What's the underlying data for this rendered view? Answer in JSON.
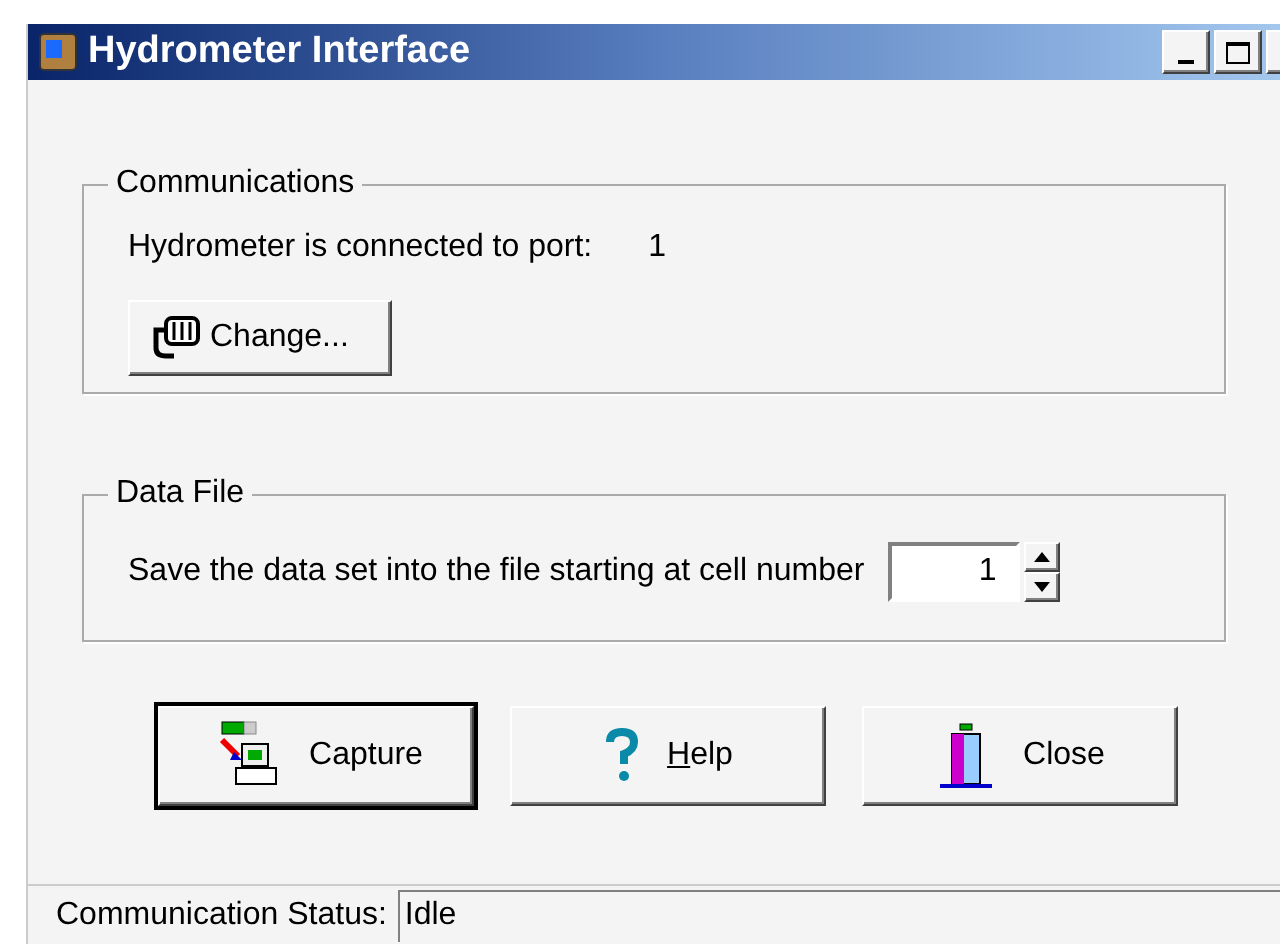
{
  "window": {
    "title": "Hydrometer Interface"
  },
  "communications": {
    "title": "Communications",
    "label": "Hydrometer is connected to port:",
    "port": "1",
    "button": "Change..."
  },
  "data_file": {
    "title": "Data File",
    "label": "Save the data set into the file starting at cell number",
    "cell": "1"
  },
  "buttons": [
    {
      "kind": "capture",
      "label": "Capture",
      "default": true,
      "mnemonic": false
    },
    {
      "kind": "help",
      "label": "Help",
      "default": false,
      "mnemonic": true
    },
    {
      "kind": "close",
      "label": "Close",
      "default": false,
      "mnemonic": false
    }
  ],
  "status_bar": {
    "label": "Communication Status:",
    "value": "Idle"
  }
}
